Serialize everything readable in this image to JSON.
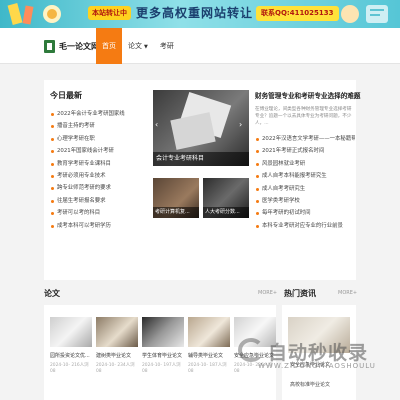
{
  "banner": {
    "tag": "本站转让中",
    "headline": "更多高权重网站转让",
    "contact": "联系QQ:411025133"
  },
  "header": {
    "logo_text": "毛一论文网",
    "nav": [
      {
        "label": "首页",
        "active": true
      },
      {
        "label": "论文",
        "has_dropdown": true
      },
      {
        "label": "考研"
      }
    ]
  },
  "latest": {
    "title": "今日最新",
    "items": [
      "2022年会计专业考研国家线",
      "播音主持的考研",
      "心理学考研在职",
      "2021年国家线会计考研",
      "教育学考研专业课科目",
      "考研必须用专业技术",
      "跨专业师范考研的要求",
      "往届生考研报名要求",
      "考研可以考的科目",
      "成考本科可以考研学历"
    ]
  },
  "slider": {
    "caption": "会计专业考研科目",
    "prev": "‹",
    "next": "›"
  },
  "thumbs": [
    {
      "caption": "考研计算机复..."
    },
    {
      "caption": "人大考研分数..."
    }
  ],
  "feature": {
    "title": "财务管理专业和考研专业选择的难题",
    "desc": "在博业理论，间类型各种财务管理专业选择考研专业？追题一个以去具体专业为考研问题，不少人，...",
    "items": [
      "2022年汉语言文学考研——一本秘籍帮你...",
      "2021年考研正式报名时间",
      "风景园林就业考研",
      "成人自考本科能报考研究生",
      "成人自考考研究生",
      "医学类考研学校",
      "每年考研的初试时间",
      "本科专业考研对应专业的行业前景"
    ]
  },
  "papers": {
    "title": "论文",
    "more": "MORE+",
    "cards": [
      {
        "title": "园所投资论文优...",
        "date": "2024-10-",
        "views": "216人浏",
        "time": "08"
      },
      {
        "title": "建树类毕业论文",
        "date": "2024-10-",
        "views": "234人浏",
        "time": "08"
      },
      {
        "title": "学生体育毕业论文",
        "date": "2024-10-",
        "views": "197人浏",
        "time": "08"
      },
      {
        "title": "辅导类毕业论文",
        "date": "2024-10-",
        "views": "187人浏",
        "time": "08"
      },
      {
        "title": "安全应急毕业论文",
        "date": "2024-10-",
        "views": "226人浏",
        "time": "08"
      }
    ]
  },
  "hot": {
    "title": "热门资讯",
    "more": "MORE+",
    "items": [
      "安全应急毕业论文",
      "高校标准毕业论文"
    ]
  },
  "watermark": {
    "big": "自动秒收录",
    "small": "WWW.ZIDONGMIAOSHOULU"
  },
  "colors": {
    "accent": "#f57b12",
    "banner": "#3fb8c9",
    "logo_green": "#2e7a3b"
  }
}
